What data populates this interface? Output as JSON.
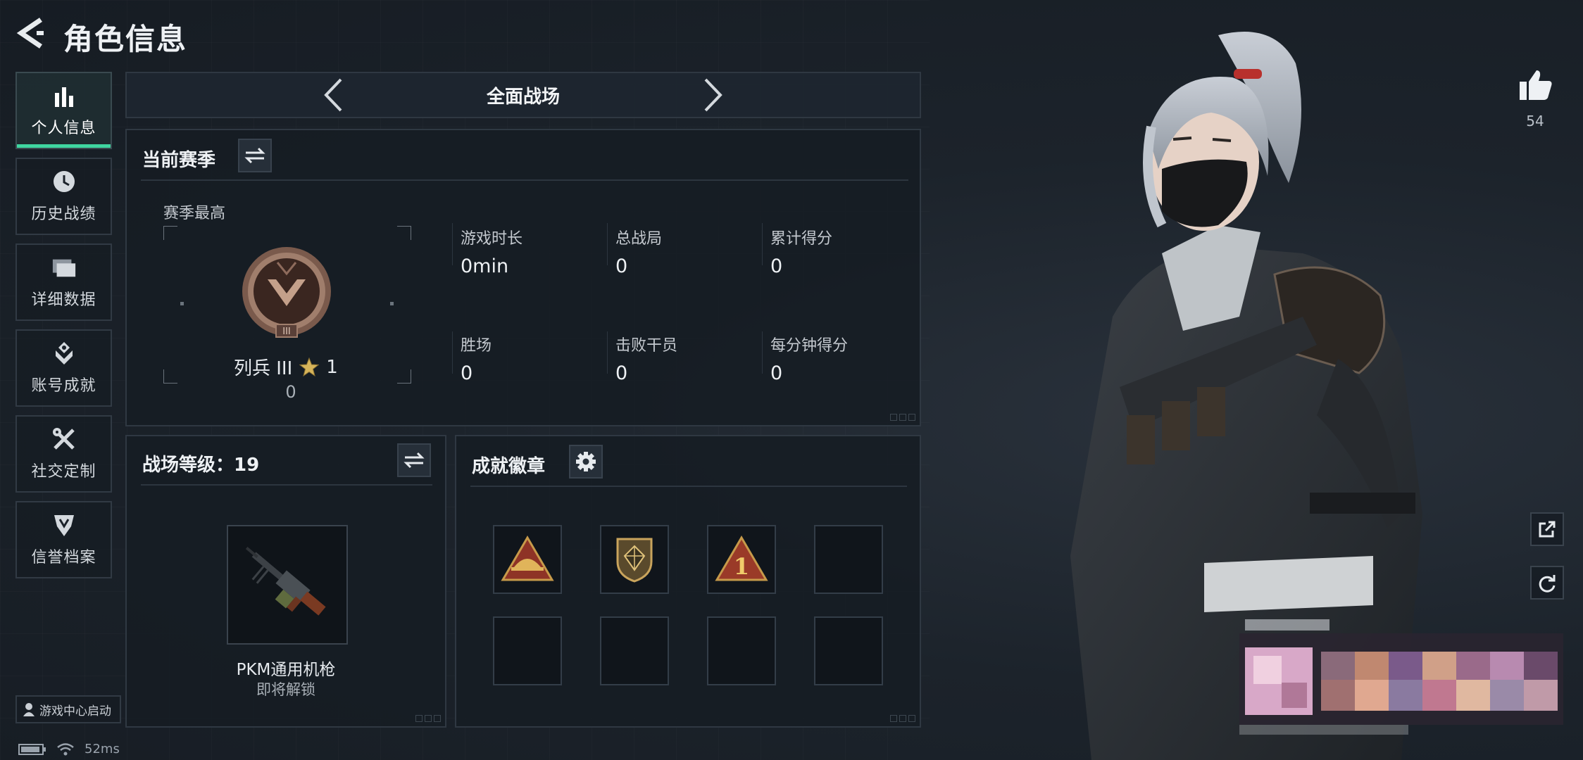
{
  "header": {
    "title": "角色信息"
  },
  "sidebar": {
    "items": [
      {
        "label": "个人信息",
        "icon": "bar-chart-icon",
        "active": true
      },
      {
        "label": "历史战绩",
        "icon": "clock-icon"
      },
      {
        "label": "详细数据",
        "icon": "folder-icon"
      },
      {
        "label": "账号成就",
        "icon": "achievement-icon"
      },
      {
        "label": "社交定制",
        "icon": "tools-icon"
      },
      {
        "label": "信誉档案",
        "icon": "shield-icon"
      }
    ],
    "launch_label": "游戏中心启动"
  },
  "status": {
    "ping": "52ms"
  },
  "mode": {
    "label": "全面战场"
  },
  "season": {
    "title": "当前赛季",
    "best_label": "赛季最高",
    "rank_name": "列兵 III",
    "rank_stars": "1",
    "rank_points": "0",
    "stats": [
      {
        "label": "游戏时长",
        "value": "0min"
      },
      {
        "label": "总战局",
        "value": "0"
      },
      {
        "label": "累计得分",
        "value": "0"
      },
      {
        "label": "胜场",
        "value": "0"
      },
      {
        "label": "击败干员",
        "value": "0"
      },
      {
        "label": "每分钟得分",
        "value": "0"
      }
    ]
  },
  "battlefield": {
    "title": "战场等级：19",
    "weapon_name": "PKM通用机枪",
    "weapon_status": "即将解锁"
  },
  "badges": {
    "title": "成就徽章",
    "slots": [
      "hat-triangle-badge",
      "shield-gem-badge",
      "number-one-badge",
      "empty",
      "empty",
      "empty",
      "empty",
      "empty"
    ]
  },
  "profile": {
    "likes": "54"
  },
  "colors": {
    "accent": "#3fd6a0",
    "background": "#1a2129",
    "panel": "#161c23"
  }
}
